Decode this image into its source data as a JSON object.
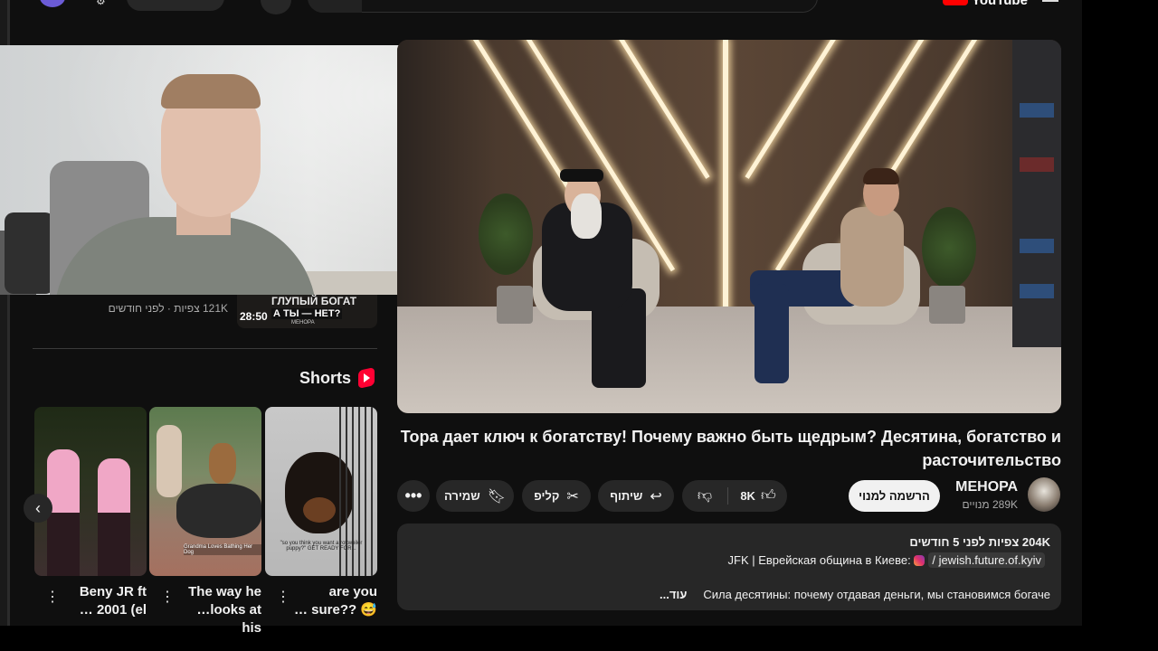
{
  "header": {
    "logo_text": "YouTube"
  },
  "previous_video": {
    "meta": "121K צפיות · לפני חודשים",
    "duration": "28:50",
    "thumb_title_line1": "ГЛУПЫЙ БОГАТ",
    "thumb_title_line2": "А ТЫ — НЕТ?",
    "thumb_brand": "МЕНОРА"
  },
  "shorts": {
    "title": "Shorts",
    "items": [
      {
        "title_line1": "Beny JR ft",
        "title_line2": "… 2001 (el"
      },
      {
        "title_line1": "The way he",
        "title_line2": "…looks at his",
        "caption": "Grandma Loves Bathing Her Dog"
      },
      {
        "title_line1": "are you",
        "title_line2": "… sure?? 😅",
        "caption": "\"so you think you want a rottweiler puppy?\" GET READY FOR..."
      }
    ]
  },
  "video": {
    "title": "Тора дает ключ к богатству! Почему важно быть щедрым? Десятина, богатство и расточительство"
  },
  "actions": {
    "save_label": "שמירה",
    "clip_label": "קליפ",
    "share_label": "שיתוף",
    "like_count": "8K",
    "more_label": "•••"
  },
  "channel": {
    "name": "МЕНОРА",
    "subscribers": "289K מנויים",
    "subscribe_label": "הרשמה למנוי"
  },
  "description": {
    "meta": "204K צפיות  לפני 5 חודשים",
    "line2_prefix": "JFK | Еврейская община в Киеве: ",
    "instagram_handle": "/ jewish.future.of.kyiv",
    "line3": "Сила десятины: почему отдавая деньги, мы становимся богаче",
    "more_label": "...עוד"
  },
  "colors": {
    "background": "#0f0f0f",
    "surface": "#272727",
    "accent": "#ff0000",
    "subscribe_bg": "#f1f1f1"
  }
}
